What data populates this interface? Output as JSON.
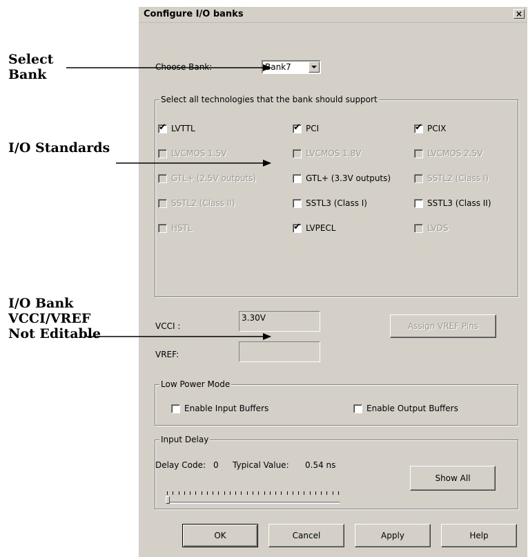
{
  "annotations": {
    "select_bank": [
      "Select",
      "Bank"
    ],
    "io_standards": [
      "I/O Standards"
    ],
    "vcci_vref": [
      "I/O Bank",
      "VCCI/VREF",
      "Not Editable"
    ]
  },
  "dialog": {
    "title": "Configure I/O banks",
    "close_glyph": "×",
    "choose_bank_label": "Choose Bank:",
    "bank_value": "Bank7",
    "technologies_group_label": "Select all technologies that the bank should support",
    "technologies": [
      {
        "label": "LVTTL",
        "checked": true,
        "enabled": true
      },
      {
        "label": "PCI",
        "checked": true,
        "enabled": true
      },
      {
        "label": "PCIX",
        "checked": true,
        "enabled": true
      },
      {
        "label": "LVCMOS 1.5V",
        "checked": false,
        "enabled": false
      },
      {
        "label": "LVCMOS 1.8V",
        "checked": false,
        "enabled": false
      },
      {
        "label": "LVCMOS 2.5V",
        "checked": false,
        "enabled": false
      },
      {
        "label": "GTL+ (2.5V outputs)",
        "checked": false,
        "enabled": false
      },
      {
        "label": "GTL+ (3.3V outputs)",
        "checked": false,
        "enabled": true
      },
      {
        "label": "SSTL2 (Class I)",
        "checked": false,
        "enabled": false
      },
      {
        "label": "SSTL2 (Class II)",
        "checked": false,
        "enabled": false
      },
      {
        "label": "SSTL3 (Class I)",
        "checked": false,
        "enabled": true
      },
      {
        "label": "SSTL3 (Class II)",
        "checked": false,
        "enabled": true
      },
      {
        "label": "HSTL",
        "checked": false,
        "enabled": false
      },
      {
        "label": "LVPECL",
        "checked": true,
        "enabled": true
      },
      {
        "label": "LVDS",
        "checked": false,
        "enabled": false
      }
    ],
    "vcci_label": "VCCI :",
    "vcci_value": "3.30V",
    "vref_label": "VREF:",
    "vref_value": "",
    "assign_vref_button": "Assign VREF Pins",
    "low_power": {
      "group_label": "Low Power Mode",
      "enable_input": "Enable Input Buffers",
      "enable_output": "Enable Output Buffers"
    },
    "input_delay": {
      "group_label": "Input Delay",
      "delay_code_label": "Delay Code:",
      "delay_code_value": "0",
      "typical_label": "Typical Value:",
      "typical_value": "0.54 ns",
      "show_all_button": "Show All",
      "slider_value_fraction": 0
    },
    "buttons": {
      "ok": "OK",
      "cancel": "Cancel",
      "apply": "Apply",
      "help": "Help"
    }
  }
}
